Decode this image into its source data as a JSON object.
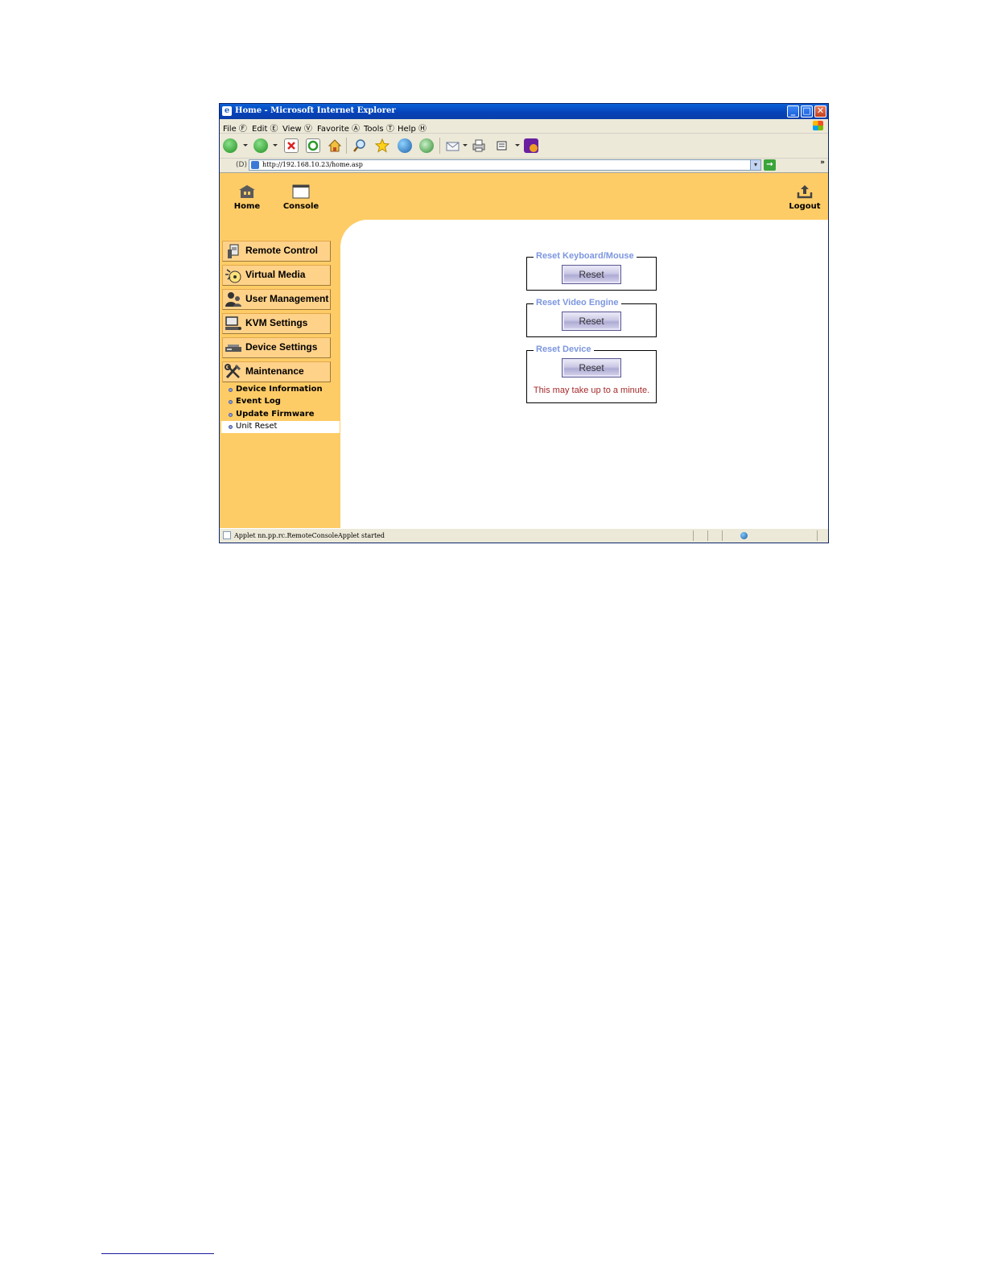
{
  "window": {
    "title": "Home - Microsoft Internet Explorer",
    "controls": {
      "minimize": "_",
      "maximize": "□",
      "close": "✕"
    }
  },
  "menu": [
    "File Ⓕ",
    "Edit Ⓔ",
    "View Ⓥ",
    "Favorite Ⓐ",
    "Tools Ⓣ",
    "Help Ⓗ"
  ],
  "address": {
    "label": "(D)",
    "url": "http://192.168.10.23/home.asp",
    "go": "→",
    "more": "»"
  },
  "top_nav": {
    "home": "Home",
    "console": "Console",
    "logout": "Logout"
  },
  "sidebar": {
    "menus": [
      {
        "label": "Remote Control",
        "icon": "remote-control-icon"
      },
      {
        "label": "Virtual Media",
        "icon": "virtual-media-icon"
      },
      {
        "label": "User Management",
        "icon": "user-management-icon"
      },
      {
        "label": "KVM Settings",
        "icon": "kvm-settings-icon"
      },
      {
        "label": "Device Settings",
        "icon": "device-settings-icon"
      },
      {
        "label": "Maintenance",
        "icon": "maintenance-icon"
      }
    ],
    "submenu": [
      {
        "label": "Device Information",
        "active": false
      },
      {
        "label": "Event Log",
        "active": false
      },
      {
        "label": "Update Firmware",
        "active": false
      },
      {
        "label": "Unit Reset",
        "active": true
      }
    ]
  },
  "reset_groups": [
    {
      "legend": "Reset Keyboard/Mouse",
      "button": "Reset"
    },
    {
      "legend": "Reset Video Engine",
      "button": "Reset"
    },
    {
      "legend": "Reset Device",
      "button": "Reset",
      "note": "This may take up to a minute."
    }
  ],
  "status": {
    "text": "Applet nn.pp.rc.RemoteConsoleApplet started"
  },
  "colors": {
    "page_background": "#fecc66",
    "legend_text": "#7c96e0",
    "note_text": "#a52a2a"
  }
}
